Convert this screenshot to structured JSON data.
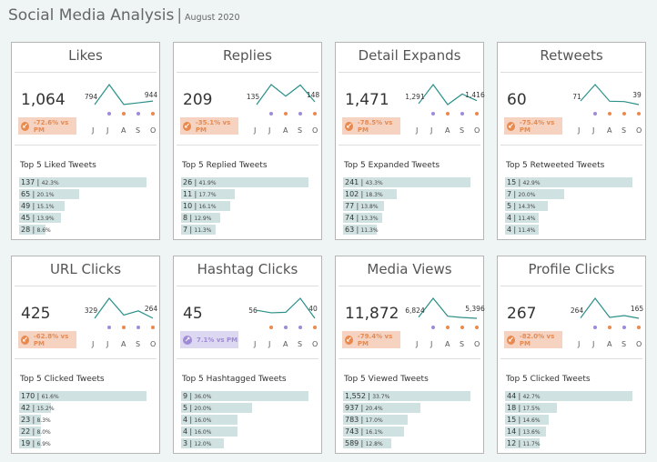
{
  "header": {
    "title": "Social Media Analysis",
    "separator": "|",
    "subtitle": "August 2020"
  },
  "colors": {
    "down": "#e8894f",
    "down_bg": "#f5d3c0",
    "up": "#9f8ad6",
    "up_bg": "#ddd8f2",
    "line": "#2a9088",
    "bar": "#cfe2e1",
    "purple_dot": "#9f8ad6",
    "orange_dot": "#e8894f"
  },
  "months": [
    "J",
    "J",
    "A",
    "S",
    "O"
  ],
  "cards": [
    {
      "title": "Likes",
      "value": "1,064",
      "change": "-72.6% vs PM",
      "direction": "down",
      "spark": [
        794,
        1650,
        800,
        870,
        944
      ],
      "first_label": "794",
      "last_label": "944",
      "dots": [
        null,
        "purple",
        "orange",
        "purple",
        "orange"
      ],
      "top_title": "Top 5 Liked Tweets",
      "top": [
        {
          "v": "137",
          "p": "42.3%",
          "n": 137
        },
        {
          "v": "65",
          "p": "20.1%",
          "n": 65
        },
        {
          "v": "49",
          "p": "15.1%",
          "n": 49
        },
        {
          "v": "45",
          "p": "13.9%",
          "n": 45
        },
        {
          "v": "28",
          "p": "8.6%",
          "n": 28
        }
      ]
    },
    {
      "title": "Replies",
      "value": "209",
      "change": "-35.1% vs PM",
      "direction": "down",
      "spark": [
        135,
        230,
        175,
        228,
        148
      ],
      "first_label": "135",
      "last_label": "148",
      "dots": [
        null,
        "purple",
        "orange",
        "purple",
        "orange"
      ],
      "top_title": "Top 5 Replied Tweets",
      "top": [
        {
          "v": "26",
          "p": "41.9%",
          "n": 26
        },
        {
          "v": "11",
          "p": "17.7%",
          "n": 11
        },
        {
          "v": "10",
          "p": "16.1%",
          "n": 10
        },
        {
          "v": "8",
          "p": "12.9%",
          "n": 8
        },
        {
          "v": "7",
          "p": "11.3%",
          "n": 7
        }
      ]
    },
    {
      "title": "Detail Expands",
      "value": "1,471",
      "change": "-78.5% vs PM",
      "direction": "down",
      "spark": [
        1291,
        2100,
        1250,
        1700,
        1416
      ],
      "first_label": "1,291",
      "last_label": "1,416",
      "dots": [
        null,
        "purple",
        "orange",
        "purple",
        "orange"
      ],
      "top_title": "Top 5 Expanded Tweets",
      "top": [
        {
          "v": "241",
          "p": "43.3%",
          "n": 241
        },
        {
          "v": "102",
          "p": "18.3%",
          "n": 102
        },
        {
          "v": "77",
          "p": "13.8%",
          "n": 77
        },
        {
          "v": "74",
          "p": "13.3%",
          "n": 74
        },
        {
          "v": "63",
          "p": "11.3%",
          "n": 63
        }
      ]
    },
    {
      "title": "Retweets",
      "value": "60",
      "change": "-75.4% vs PM",
      "direction": "down",
      "spark": [
        71,
        120,
        70,
        69,
        60
      ],
      "first_label": "71",
      "last_label": "39",
      "dots": [
        null,
        "purple",
        "orange",
        "orange",
        "orange"
      ],
      "top_title": "Top 5 Retweeted Tweets",
      "top": [
        {
          "v": "15",
          "p": "42.9%",
          "n": 15
        },
        {
          "v": "7",
          "p": "20.0%",
          "n": 7
        },
        {
          "v": "5",
          "p": "14.3%",
          "n": 5
        },
        {
          "v": "4",
          "p": "11.4%",
          "n": 4
        },
        {
          "v": "4",
          "p": "11.4%",
          "n": 4
        }
      ]
    },
    {
      "title": "URL Clicks",
      "value": "425",
      "change": "-62.8% vs PM",
      "direction": "down",
      "spark": [
        329,
        520,
        360,
        400,
        330
      ],
      "first_label": "329",
      "last_label": "264",
      "dots": [
        null,
        "purple",
        "orange",
        "purple",
        "orange"
      ],
      "top_title": "Top 5 Clicked Tweets",
      "top": [
        {
          "v": "170",
          "p": "61.6%",
          "n": 170
        },
        {
          "v": "42",
          "p": "15.2%",
          "n": 42
        },
        {
          "v": "23",
          "p": "8.3%",
          "n": 23
        },
        {
          "v": "22",
          "p": "8.0%",
          "n": 22
        },
        {
          "v": "19",
          "p": "6.9%",
          "n": 19
        }
      ]
    },
    {
      "title": "Hashtag Clicks",
      "value": "45",
      "change": "7.1% vs PM",
      "direction": "up",
      "spark": [
        56,
        51,
        52,
        80,
        40
      ],
      "first_label": "56",
      "last_label": "40",
      "dots": [
        null,
        "orange",
        "purple",
        "purple",
        "orange"
      ],
      "top_title": "Top 5 Hashtagged Tweets",
      "top": [
        {
          "v": "9",
          "p": "36.0%",
          "n": 9
        },
        {
          "v": "5",
          "p": "20.0%",
          "n": 5
        },
        {
          "v": "4",
          "p": "16.0%",
          "n": 4
        },
        {
          "v": "4",
          "p": "16.0%",
          "n": 4
        },
        {
          "v": "3",
          "p": "12.0%",
          "n": 3
        }
      ]
    },
    {
      "title": "Media Views",
      "value": "11,872",
      "change": "-79.4% vs PM",
      "direction": "down",
      "spark": [
        6824,
        14000,
        7200,
        6700,
        6400
      ],
      "first_label": "6,824",
      "last_label": "5,396",
      "dots": [
        null,
        "purple",
        "orange",
        "orange",
        "orange"
      ],
      "top_title": "Top 5 Viewed Tweets",
      "top": [
        {
          "v": "1,552",
          "p": "33.7%",
          "n": 1552
        },
        {
          "v": "937",
          "p": "20.4%",
          "n": 937
        },
        {
          "v": "783",
          "p": "17.0%",
          "n": 783
        },
        {
          "v": "743",
          "p": "16.1%",
          "n": 743
        },
        {
          "v": "589",
          "p": "12.8%",
          "n": 589
        }
      ]
    },
    {
      "title": "Profile Clicks",
      "value": "267",
      "change": "-82.0% vs PM",
      "direction": "down",
      "spark": [
        264,
        480,
        270,
        290,
        260
      ],
      "first_label": "264",
      "last_label": "165",
      "dots": [
        null,
        "purple",
        "orange",
        "purple",
        "orange"
      ],
      "top_title": "Top 5 Clicked Tweets",
      "top": [
        {
          "v": "44",
          "p": "42.7%",
          "n": 44
        },
        {
          "v": "18",
          "p": "17.5%",
          "n": 18
        },
        {
          "v": "15",
          "p": "14.6%",
          "n": 15
        },
        {
          "v": "14",
          "p": "13.6%",
          "n": 14
        },
        {
          "v": "12",
          "p": "11.7%",
          "n": 12
        }
      ]
    }
  ]
}
